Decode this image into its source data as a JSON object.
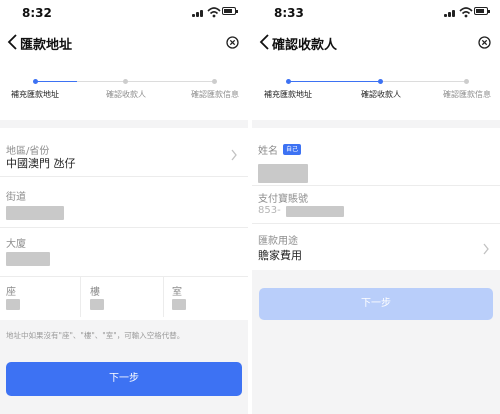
{
  "colors": {
    "accent": "#3d72f3",
    "accent_disabled": "#b9cefa",
    "inactive": "#cdcdcd"
  },
  "screen1": {
    "time": "8:32",
    "title": "匯款地址",
    "steps": [
      "補充匯款地址",
      "確認收款人",
      "確認匯款信息"
    ],
    "current_step": 1,
    "region_label": "地區/省份",
    "region_value": "中國澳門 氹仔",
    "street_label": "街道",
    "building_label": "大廈",
    "block_label": "座",
    "floor_label": "樓",
    "room_label": "室",
    "hint": "地址中如果沒有\"座\"、\"樓\"、\"室\"，可輸入空格代替。",
    "next_button": "下一步"
  },
  "screen2": {
    "time": "8:33",
    "title": "確認收款人",
    "steps": [
      "補充匯款地址",
      "確認收款人",
      "確認匯款信息"
    ],
    "current_step": 2,
    "name_label": "姓名",
    "self_tag": "自己",
    "account_label": "支付寶賬號",
    "account_prefix": "853-",
    "purpose_label": "匯款用途",
    "purpose_value": "贍家費用",
    "next_button": "下一步"
  }
}
